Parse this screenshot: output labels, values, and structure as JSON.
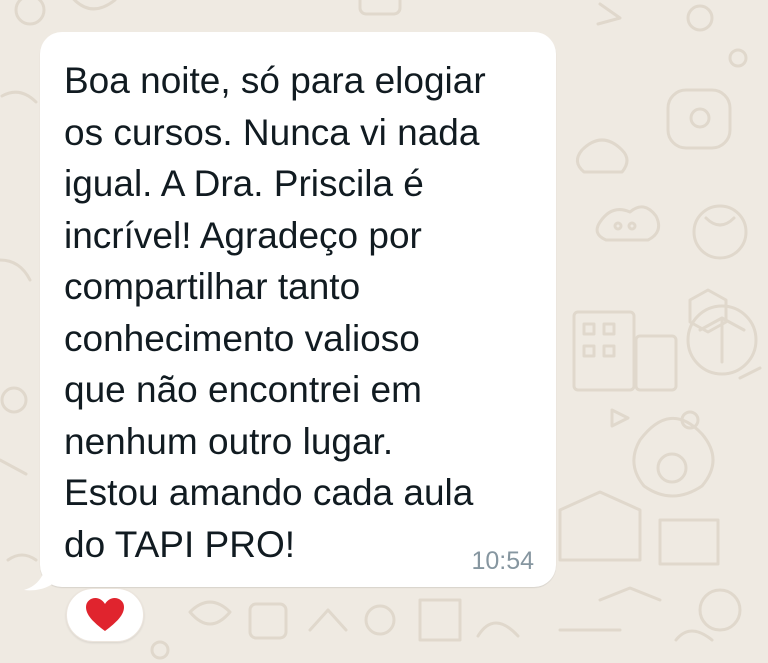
{
  "chat": {
    "message": {
      "text": "Boa noite, só para elogiar\nos cursos. Nunca vi nada\nigual. A Dra. Priscila é\nincrível! Agradeço por\ncompartilhar tanto\nconhecimento valioso\nque não encontrei em\nnenhum outro lugar.\nEstou amando cada aula\ndo TAPI PRO!",
      "time": "10:54",
      "reaction_icon": "red-heart-icon"
    },
    "colors": {
      "wallpaper": "#efeae2",
      "bubble": "#ffffff",
      "text": "#111b21",
      "timestamp": "#8696a0",
      "heart": "#e0242e"
    }
  }
}
